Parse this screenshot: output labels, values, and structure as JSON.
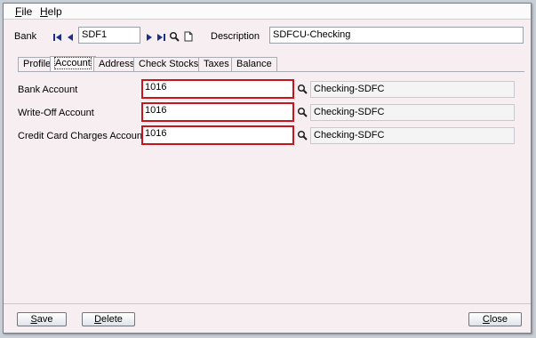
{
  "menu": [
    {
      "prefix": "",
      "mnemonic": "F",
      "rest": "ile"
    },
    {
      "prefix": "",
      "mnemonic": "H",
      "rest": "elp"
    }
  ],
  "header": {
    "bank_label": "Bank",
    "bank_value": "SDF1",
    "description_label": "Description",
    "description_value": "SDFCU-Checking"
  },
  "tabs": [
    {
      "label": "Profile"
    },
    {
      "label": "Account"
    },
    {
      "label": "Address"
    },
    {
      "label": "Check Stocks"
    },
    {
      "label": "Taxes"
    },
    {
      "label": "Balance"
    }
  ],
  "active_tab": "Account",
  "accounts": [
    {
      "label": "Bank Account",
      "value": "1016",
      "description": "Checking-SDFC"
    },
    {
      "label": "Write-Off Account",
      "value": "1016",
      "description": "Checking-SDFC"
    },
    {
      "label": "Credit Card Charges Account",
      "value": "1016",
      "description": "Checking-SDFC"
    }
  ],
  "buttons": {
    "save": {
      "mnemonic": "S",
      "rest": "ave"
    },
    "delete": {
      "mnemonic": "D",
      "rest": "elete"
    },
    "close": {
      "mnemonic": "C",
      "rest": "lose"
    }
  },
  "colors": {
    "highlight_border": "#c8141c",
    "nav_blue": "#1a2f8a"
  },
  "icons": [
    "first-record-icon",
    "previous-record-icon",
    "next-record-icon",
    "last-record-icon",
    "search-icon",
    "new-document-icon"
  ]
}
